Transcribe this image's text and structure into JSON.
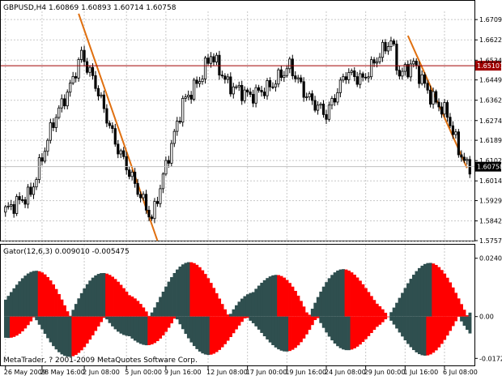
{
  "main_panel": {
    "header": "GBPUSD,H4  1.60869 1.60893 1.60714 1.60758",
    "price_ticks": [
      {
        "label": "1.67095",
        "value": 1.67095
      },
      {
        "label": "1.66220",
        "value": 1.6622
      },
      {
        "label": "1.65345",
        "value": 1.65345
      },
      {
        "label": "1.64495",
        "value": 1.64495
      },
      {
        "label": "1.63620",
        "value": 1.6362
      },
      {
        "label": "1.62745",
        "value": 1.62745
      },
      {
        "label": "1.61895",
        "value": 1.61895
      },
      {
        "label": "1.61020",
        "value": 1.6102
      },
      {
        "label": "1.60145",
        "value": 1.60145
      },
      {
        "label": "1.59295",
        "value": 1.59295
      },
      {
        "label": "1.58420",
        "value": 1.5842
      },
      {
        "label": "1.57570",
        "value": 1.5757
      }
    ],
    "price_range": [
      1.5757,
      1.6745
    ],
    "horizontal_line": {
      "value": 1.65107,
      "label": "1.65107",
      "color": "#a00000"
    },
    "current_price": {
      "value": 1.60758,
      "label": "1.60758"
    },
    "trendline_color": "#e07010",
    "trendlines": [
      {
        "from": {
          "bar": 26,
          "price": 1.6735
        },
        "to": {
          "bar": 54,
          "price": 1.5757
        }
      },
      {
        "from": {
          "bar": 143,
          "price": 1.664
        },
        "to": {
          "bar": 164,
          "price": 1.607
        }
      }
    ],
    "bar_count": 166
  },
  "gator_panel": {
    "header": "Gator(12,6,3) 0.009010 -0.005475",
    "ticks": [
      {
        "label": "0.02408",
        "value": 0.02408
      },
      {
        "label": "0.00",
        "value": 0.0
      },
      {
        "label": "-0.01727",
        "value": -0.01727
      }
    ],
    "range": [
      -0.0185,
      0.025
    ],
    "up_color": "#ff0000",
    "down_color": "#2f4f4f",
    "copyright": "MetaTrader, ? 2001-2009 MetaQuotes Software Corp."
  },
  "time_axis": [
    {
      "label": "26 May 2009",
      "bar": 0
    },
    {
      "label": "28 May 16:00",
      "bar": 13
    },
    {
      "label": "2 Jun 08:00",
      "bar": 28
    },
    {
      "label": "5 Jun 00:00",
      "bar": 43
    },
    {
      "label": "9 Jun 16:00",
      "bar": 57
    },
    {
      "label": "12 Jun 08:00",
      "bar": 72
    },
    {
      "label": "17 Jun 00:00",
      "bar": 86
    },
    {
      "label": "19 Jun 16:00",
      "bar": 100
    },
    {
      "label": "24 Jun 08:00",
      "bar": 114
    },
    {
      "label": "29 Jun 00:00",
      "bar": 128
    },
    {
      "label": "1 Jul 16:00",
      "bar": 142
    },
    {
      "label": "6 Jul 08:00",
      "bar": 156
    }
  ]
}
